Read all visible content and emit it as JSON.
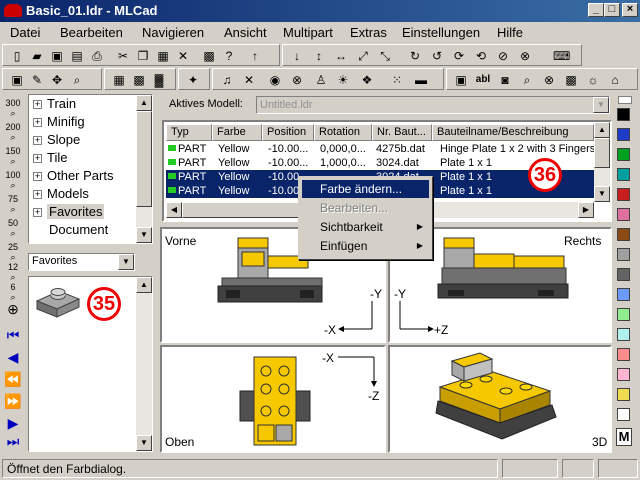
{
  "window": {
    "title": "Basic_01.ldr - MLCad",
    "minimize": "_",
    "maximize": "□",
    "close": "×"
  },
  "menu": [
    "Datei",
    "Bearbeiten",
    "Navigieren",
    "Ansicht",
    "Multipart",
    "Extras",
    "Einstellungen",
    "Hilfe"
  ],
  "tree": {
    "items": [
      {
        "label": "Train",
        "expander": "+"
      },
      {
        "label": "Minifig",
        "expander": "+"
      },
      {
        "label": "Slope",
        "expander": "+"
      },
      {
        "label": "Tile",
        "expander": "+"
      },
      {
        "label": "Other Parts",
        "expander": "+"
      },
      {
        "label": "Models",
        "expander": "+"
      },
      {
        "label": "Favorites",
        "expander": "+"
      },
      {
        "label": "Document",
        "expander": ""
      }
    ]
  },
  "favorites": {
    "selected": "Favorites",
    "badge": "35"
  },
  "model": {
    "label": "Aktives Modell:",
    "value": "Untitled.ldr",
    "badge": "36"
  },
  "list": {
    "headers": [
      "Typ",
      "Farbe",
      "Position",
      "Rotation",
      "Nr. Baut...",
      "Bauteilname/Beschreibung"
    ],
    "rows": [
      {
        "type": "PART",
        "color": "Yellow",
        "pos": "-10.00...",
        "rot": "0,000,0...",
        "nr": "4275b.dat",
        "desc": "Hinge Plate  1 x  2 with 3 Fingers",
        "selected": false
      },
      {
        "type": "PART",
        "color": "Yellow",
        "pos": "-10.00...",
        "rot": "1,000,0...",
        "nr": "3024.dat",
        "desc": "Plate  1 x  1",
        "selected": false
      },
      {
        "type": "PART",
        "color": "Yellow",
        "pos": "-10.00...",
        "rot": "",
        "nr": "3024.dat",
        "desc": "Plate  1 x  1",
        "selected": true
      },
      {
        "type": "PART",
        "color": "Yellow",
        "pos": "-10.00...",
        "rot": "",
        "nr": "",
        "desc": "Plate  1 x  1",
        "selected": true
      }
    ]
  },
  "context_menu": {
    "items": [
      {
        "label": "Farbe ändern...",
        "state": "highlighted",
        "submenu": false
      },
      {
        "label": "Bearbeiten...",
        "state": "disabled",
        "submenu": false
      },
      {
        "label": "Sichtbarkeit",
        "state": "normal",
        "submenu": true
      },
      {
        "label": "Einfügen",
        "state": "normal",
        "submenu": true
      }
    ]
  },
  "viewports": {
    "front": {
      "label": "Vorne",
      "axis_v": "-Y",
      "axis_h": "-X"
    },
    "right": {
      "label": "Rechts",
      "axis_v": "-Y",
      "axis_h": "+Z"
    },
    "top": {
      "label": "Oben",
      "axis_v": "-Z",
      "axis_h": "-X"
    },
    "persp": {
      "label": "3D"
    }
  },
  "left_icons": [
    "300",
    "200",
    "150",
    "100",
    "75",
    "50",
    "25",
    "12",
    "6"
  ],
  "palette": {
    "colors": [
      "#000000",
      "#1e3cc8",
      "#00a020",
      "#00a0a0",
      "#c81e1e",
      "#e070a0",
      "#8c4a14",
      "#a0a0a0",
      "#646464",
      "#6b9bff",
      "#90ee90",
      "#b0f0f0",
      "#ff8c8c",
      "#ffb4d2",
      "#f0dc50",
      "#ffffff"
    ],
    "m_label": "M"
  },
  "status": {
    "text": "Öffnet den Farbdialog."
  }
}
